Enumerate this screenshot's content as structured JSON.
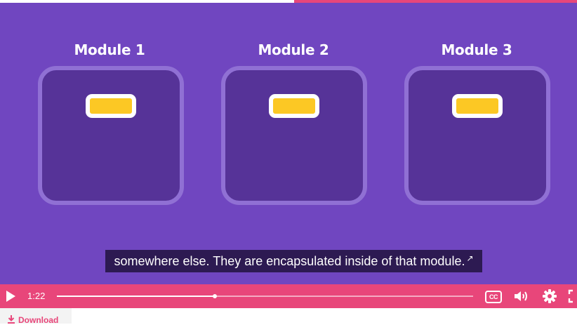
{
  "top_progress": {
    "fraction": 0.49
  },
  "modules": [
    {
      "title": "Module 1"
    },
    {
      "title": "Module 2"
    },
    {
      "title": "Module 3"
    }
  ],
  "caption": {
    "text": "somewhere else. They are encapsulated inside of that module.",
    "arrow": "↗"
  },
  "player": {
    "time": "1:22",
    "progress_fraction": 0.38,
    "cc_label": "CC"
  },
  "download": {
    "label": "Download"
  },
  "colors": {
    "accent": "#e8467a",
    "background": "#7046c0",
    "module_fill": "#563398",
    "chip": "#fcc824"
  },
  "icons": {
    "play": "play-icon",
    "cc": "closed-captions-icon",
    "volume": "volume-icon",
    "settings": "gear-icon",
    "fullscreen": "fullscreen-icon",
    "download": "download-icon"
  }
}
